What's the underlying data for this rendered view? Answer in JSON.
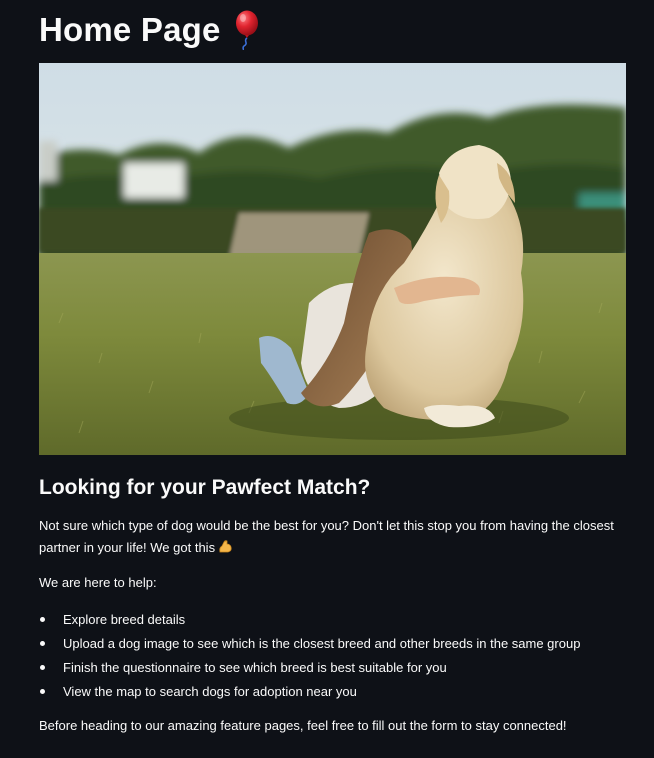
{
  "page": {
    "title": "Home Page",
    "title_icon": "balloon-icon"
  },
  "hero": {
    "alt": "Girl hugging a golden retriever in a grassy field",
    "icon": "hero-photo"
  },
  "main": {
    "subheader": "Looking for your Pawfect Match?",
    "intro": "Not sure which type of dog would be the best for you? Don't let this stop you from having the closest partner in your life! We got this",
    "intro_icon": "flexed-biceps-icon",
    "help_text": "We are here to help:",
    "features": [
      "Explore breed details",
      "Upload a dog image to see which is the closest breed and other breeds in the same group",
      "Finish the questionnaire to see which breed is best suitable for you",
      "View the map to search dogs for adoption near you"
    ],
    "outro": "Before heading to our amazing feature pages, feel free to fill out the form to stay connected!"
  },
  "colors": {
    "background": "#0e1117",
    "text": "#fafafa",
    "balloon": "#e0242f"
  }
}
